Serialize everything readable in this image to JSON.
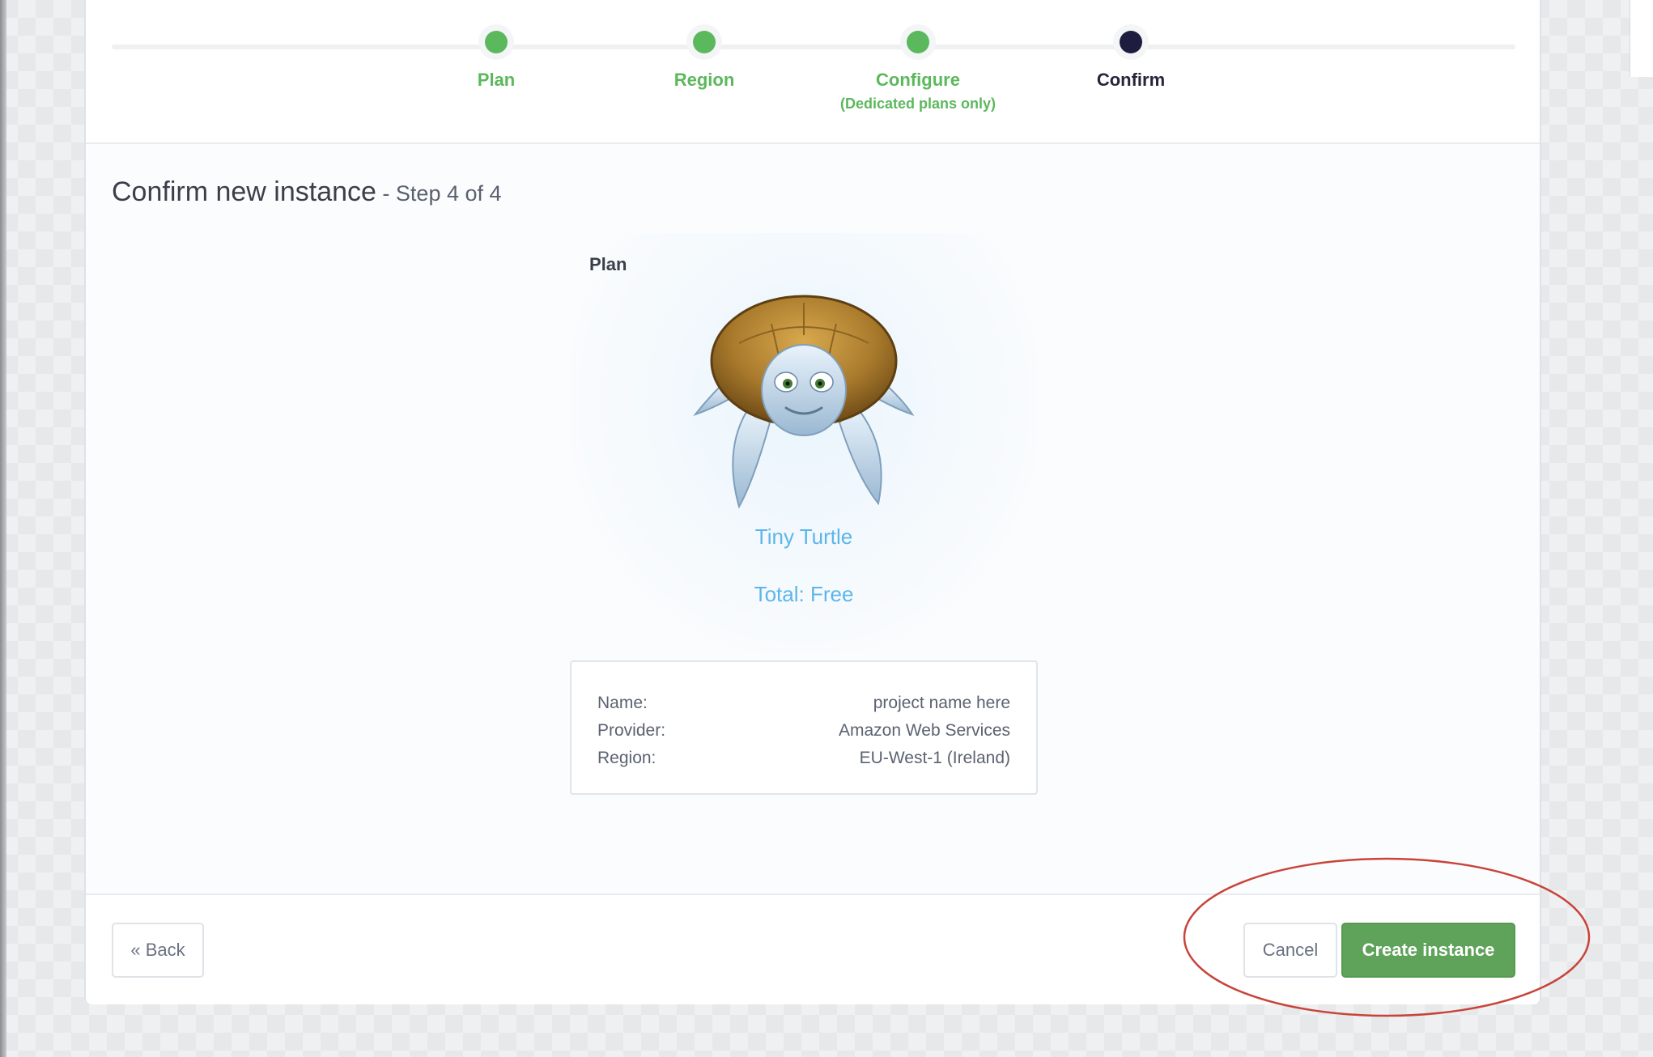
{
  "stepper": {
    "steps": [
      {
        "label": "Plan",
        "sub": "",
        "state": "done"
      },
      {
        "label": "Region",
        "sub": "",
        "state": "done"
      },
      {
        "label": "Configure",
        "sub": "(Dedicated plans only)",
        "state": "done"
      },
      {
        "label": "Confirm",
        "sub": "",
        "state": "current"
      }
    ]
  },
  "page": {
    "title": "Confirm new instance",
    "step_text": " - Step 4 of 4"
  },
  "plan": {
    "heading": "Plan",
    "name": "Tiny Turtle",
    "total": "Total: Free",
    "image": "turtle-mascot"
  },
  "summary": {
    "rows": [
      {
        "label": "Name:",
        "value": "project name here"
      },
      {
        "label": "Provider:",
        "value": "Amazon Web Services"
      },
      {
        "label": "Region:",
        "value": "EU-West-1 (Ireland)"
      }
    ]
  },
  "footer": {
    "back_label": "« Back",
    "cancel_label": "Cancel",
    "create_label": "Create instance"
  },
  "colors": {
    "done": "#5cb85c",
    "current": "#1f1d3f",
    "plan_text": "#5cb6ea",
    "create_button": "#5fa25a",
    "annotation": "#c8443a"
  }
}
